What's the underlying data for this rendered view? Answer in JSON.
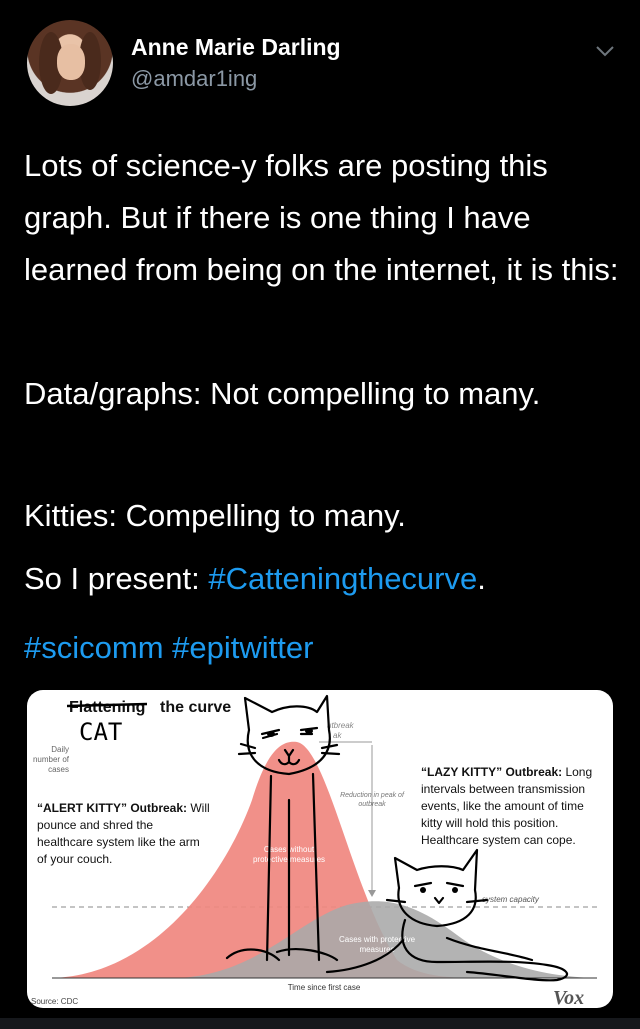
{
  "author": {
    "display_name": "Anne Marie Darling",
    "handle": "@amdar1ing"
  },
  "tweet": {
    "para1": "Lots of science-y folks are posting this graph. But if there is one thing I have learned from being on the internet, it is this:",
    "para2": "Data/graphs: Not compelling to many.",
    "para3": "Kitties: Compelling to many.",
    "para4_prefix": "So I present: ",
    "para4_hashtag": "#Catteningthecurve",
    "para4_suffix": ".",
    "para5_hashtag1": "#scicomm",
    "para5_hashtag2": "#epitwitter"
  },
  "image": {
    "title_struck": "Flattening",
    "title_rest": "the curve",
    "title_scrawl": "CAT",
    "ylabel_line1": "Daily",
    "ylabel_line2": "number of",
    "ylabel_line3": "cases",
    "peak_label_line1": "utbreak",
    "peak_label_line2": "ak",
    "reduction_line1": "Reduction in peak of",
    "reduction_line2": "outbreak",
    "without_line1": "Cases without",
    "without_line2": "protective measures",
    "with_line1": "Cases with protective",
    "with_line2": "measures",
    "capacity_label": "system capacity",
    "xlabel": "Time since first case",
    "source": "Source: CDC",
    "brand": "Vox",
    "alert_heading": "“ALERT KITTY” Outbreak:",
    "alert_line1_rest": " Will",
    "alert_line2": "pounce and shred the",
    "alert_line3": "healthcare system like the arm",
    "alert_line4": "of your couch.",
    "lazy_heading": "“LAZY KITTY” Outbreak:",
    "lazy_line1_rest": " Long",
    "lazy_line2": "intervals between transmission",
    "lazy_line3": "events, like the amount of time",
    "lazy_line4": "kitty will hold this position.",
    "lazy_line5": "Healthcare system can cope."
  },
  "colors": {
    "background": "#000000",
    "hashtag": "#1d9bf0",
    "handle": "#8b98a5",
    "curve_without": "#f0877f",
    "curve_with": "#a8a8a8"
  }
}
